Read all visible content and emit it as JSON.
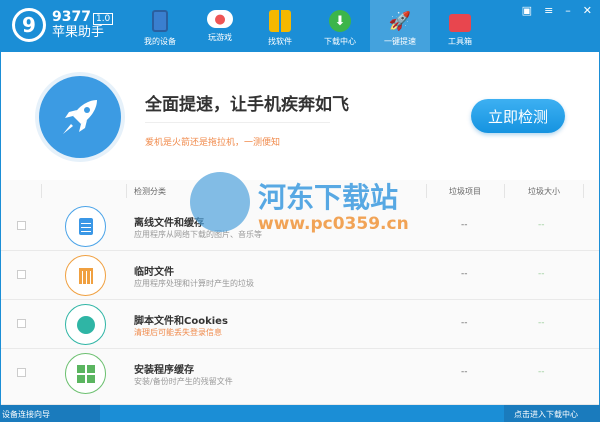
{
  "app": {
    "logo_number": "9377",
    "version": "1.0",
    "name": "苹果助手"
  },
  "nav": [
    {
      "label": "我的设备",
      "icon": "tablet-icon"
    },
    {
      "label": "玩游戏",
      "icon": "gamepad-icon"
    },
    {
      "label": "找软件",
      "icon": "apps-grid-icon"
    },
    {
      "label": "下载中心",
      "icon": "download-icon"
    },
    {
      "label": "一键提速",
      "icon": "rocket-icon",
      "active": true
    },
    {
      "label": "工具箱",
      "icon": "toolbox-icon"
    }
  ],
  "window_controls": [
    "feedback-icon",
    "menu-icon",
    "minimize-icon",
    "close-icon"
  ],
  "hero": {
    "title": "全面提速，让手机疾奔如飞",
    "subtitle": "爱机是火箭还是拖拉机，一测便知",
    "button": "立即检测"
  },
  "table": {
    "headers": {
      "category": "检测分类",
      "items": "垃圾项目",
      "size": "垃圾大小"
    },
    "rows": [
      {
        "name": "离线文件和缓存",
        "desc": "应用程序从网络下载的图片、音乐等",
        "items": "--",
        "size": "--",
        "color": "#4aa3e8",
        "icon": "document-icon"
      },
      {
        "name": "临时文件",
        "desc": "应用程序处理和计算时产生的垃圾",
        "items": "--",
        "size": "--",
        "color": "#f0a040",
        "icon": "trash-icon"
      },
      {
        "name": "脚本文件和Cookies",
        "desc": "清理后可能丢失登录信息",
        "items": "--",
        "size": "--",
        "color": "#2fb5a5",
        "icon": "alarm-clock-icon",
        "desc_warning": true
      },
      {
        "name": "安装程序缓存",
        "desc": "安装/备份时产生的残留文件",
        "items": "--",
        "size": "--",
        "color": "#6cc070",
        "icon": "apps-icon"
      }
    ]
  },
  "status": {
    "left": "设备连接向导",
    "right": "点击进入下载中心"
  },
  "watermark": {
    "title": "河东下载站",
    "url": "www.pc0359.cn"
  }
}
